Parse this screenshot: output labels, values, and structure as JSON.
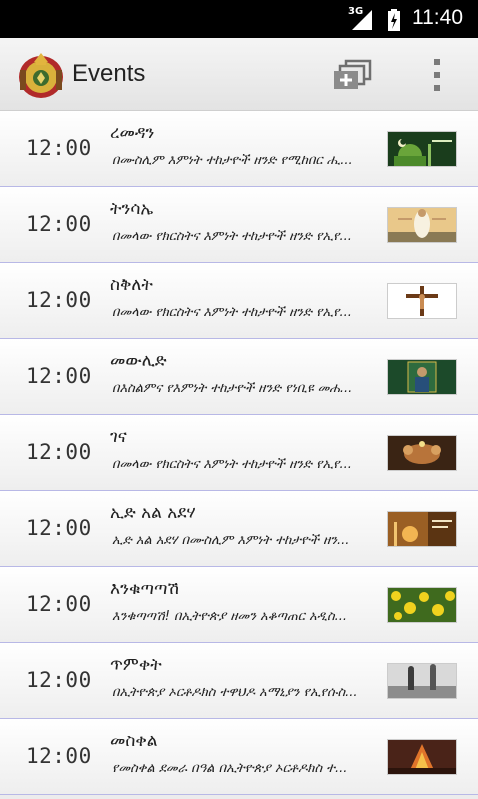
{
  "status_bar": {
    "network": "3G",
    "time": "11:40"
  },
  "app_bar": {
    "logo_icon": "imperial-crest-icon",
    "title": "Events",
    "add_icon": "add-event-icon",
    "menu_icon": "overflow-menu-icon"
  },
  "events": [
    {
      "time": "12:00",
      "title": "ረመዳን",
      "description": "በሙስሊም እምነት ተከታዮች ዘንድ የሚከበር ሒ...",
      "thumb_icon": "eid-mosque-image"
    },
    {
      "time": "12:00",
      "title": "ትንሳኤ",
      "description": "በመላው የክርስትና እምነት ተከታዮች ዘንድ የኢየ...",
      "thumb_icon": "resurrection-image"
    },
    {
      "time": "12:00",
      "title": "ስቅለት",
      "description": "በመላው የክርስትና እምነት ተከታዮች ዘንድ የኢየ...",
      "thumb_icon": "crucifix-image"
    },
    {
      "time": "12:00",
      "title": "መውሊድ",
      "description": "በእስልምና የእምነት ተከታዮች ዘንድ የነቢዩ መሐ...",
      "thumb_icon": "mawlid-image"
    },
    {
      "time": "12:00",
      "title": "ገና",
      "description": "በመላው የክርስትና እምነት ተከታዮች ዘንድ የኢየ...",
      "thumb_icon": "nativity-image"
    },
    {
      "time": "12:00",
      "title": "ኢድ አል አደሃ",
      "description": "ኢድ አል አደሃ በሙስሊም እምነት ተከታዮች ዘን...",
      "thumb_icon": "eid-mubarak-image"
    },
    {
      "time": "12:00",
      "title": "እንቁጣጣሽ",
      "description": "እንቁጣጣሽ! በኢትዮጵያ ዘመን አቆጣጠር አዲስ...",
      "thumb_icon": "yellow-flowers-image"
    },
    {
      "time": "12:00",
      "title": "ጥምቀት",
      "description": "በኢትዮጵያ ኦርቶዶክስ ተዋህዶ አማኒያን የኢየሱስ...",
      "thumb_icon": "baptism-image"
    },
    {
      "time": "12:00",
      "title": "መስቀል",
      "description": "የመስቀል ደመራ በዓል በኢትዮጵያ ኦርቶዶክስ ተ...",
      "thumb_icon": "meskel-bonfire-image"
    }
  ]
}
